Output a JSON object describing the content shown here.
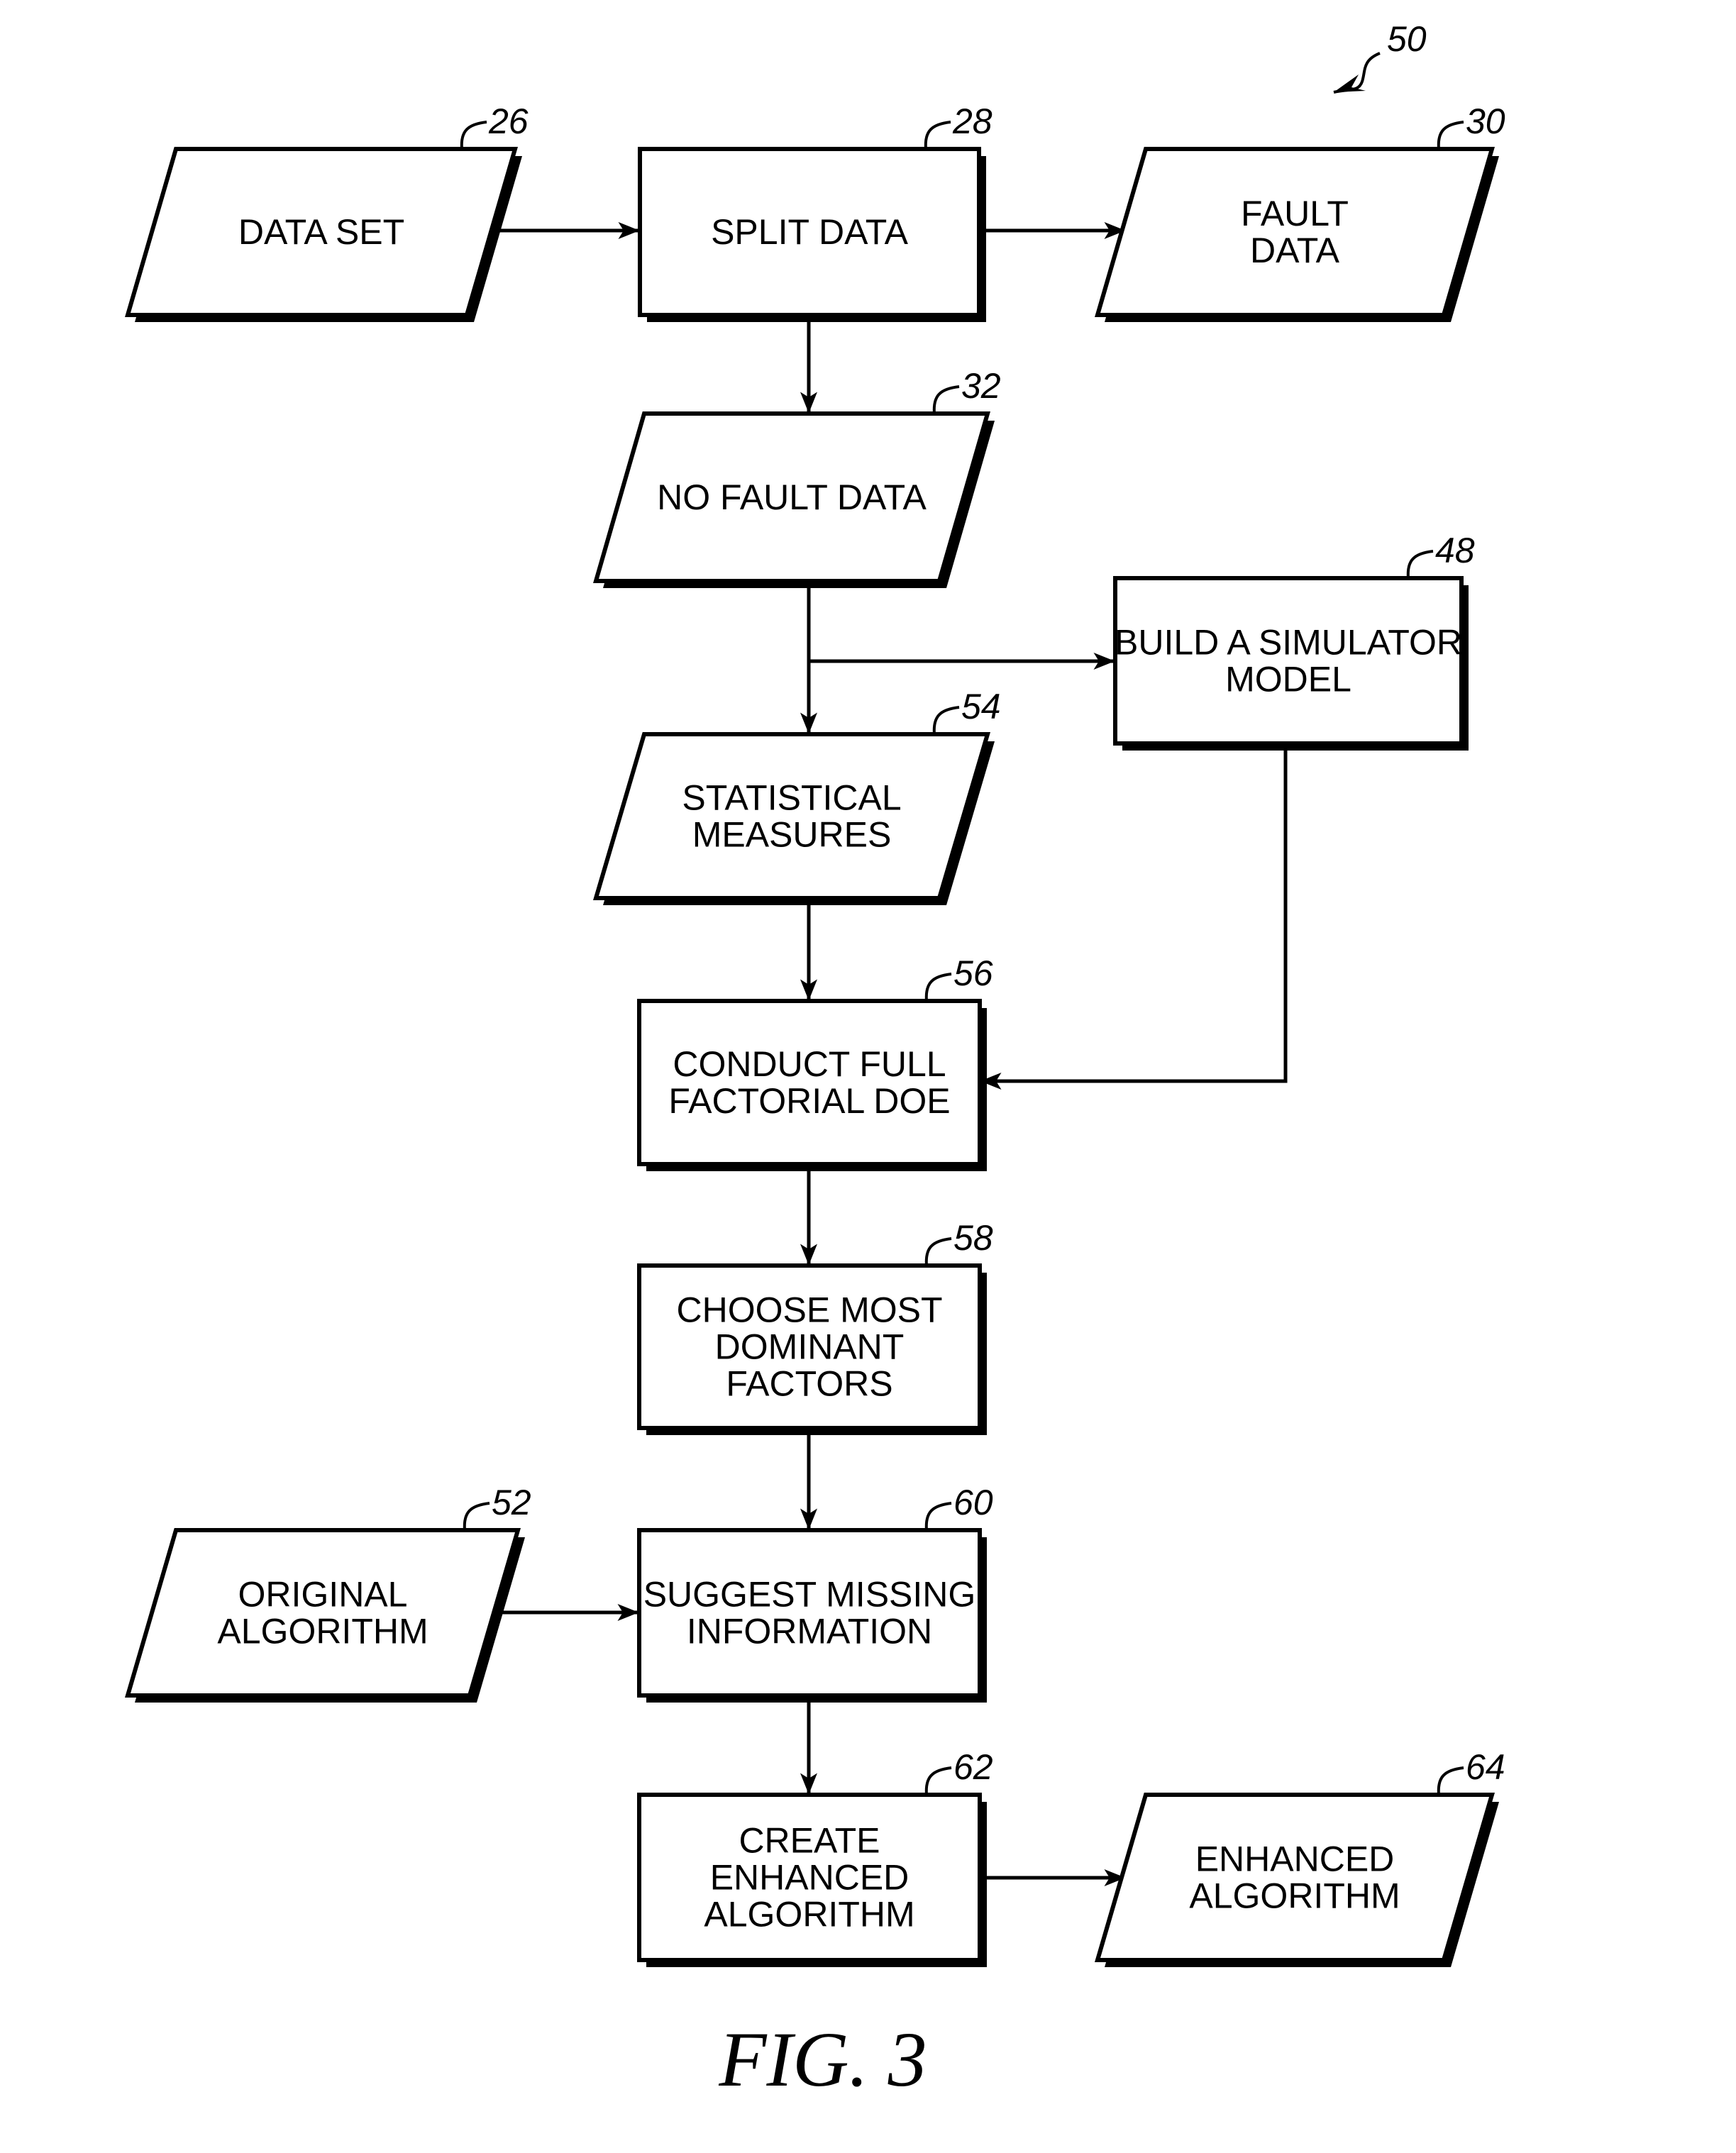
{
  "figure": {
    "caption": "FIG. 3",
    "reference": "50"
  },
  "nodes": [
    {
      "id": "data-set",
      "ref": "26",
      "shape": "parallelogram",
      "lines": [
        "DATA SET"
      ]
    },
    {
      "id": "split-data",
      "ref": "28",
      "shape": "rect",
      "lines": [
        "SPLIT DATA"
      ]
    },
    {
      "id": "fault-data",
      "ref": "30",
      "shape": "parallelogram",
      "lines": [
        "FAULT",
        "DATA"
      ]
    },
    {
      "id": "no-fault-data",
      "ref": "32",
      "shape": "parallelogram",
      "lines": [
        "NO FAULT DATA"
      ]
    },
    {
      "id": "build-simulator-model",
      "ref": "48",
      "shape": "rect",
      "lines": [
        "BUILD A SIMULATOR",
        "MODEL"
      ]
    },
    {
      "id": "statistical-measures",
      "ref": "54",
      "shape": "parallelogram",
      "lines": [
        "STATISTICAL",
        "MEASURES"
      ]
    },
    {
      "id": "conduct-full-factorial-doe",
      "ref": "56",
      "shape": "rect",
      "lines": [
        "CONDUCT FULL",
        "FACTORIAL DOE"
      ]
    },
    {
      "id": "choose-most-dominant-factors",
      "ref": "58",
      "shape": "rect",
      "lines": [
        "CHOOSE MOST",
        "DOMINANT",
        "FACTORS"
      ]
    },
    {
      "id": "original-algorithm",
      "ref": "52",
      "shape": "parallelogram",
      "lines": [
        "ORIGINAL",
        "ALGORITHM"
      ]
    },
    {
      "id": "suggest-missing-information",
      "ref": "60",
      "shape": "rect",
      "lines": [
        "SUGGEST MISSING",
        "INFORMATION"
      ]
    },
    {
      "id": "create-enhanced-algorithm",
      "ref": "62",
      "shape": "rect",
      "lines": [
        "CREATE",
        "ENHANCED",
        "ALGORITHM"
      ]
    },
    {
      "id": "enhanced-algorithm",
      "ref": "64",
      "shape": "parallelogram",
      "lines": [
        "ENHANCED",
        "ALGORITHM"
      ]
    }
  ],
  "edges": [
    {
      "from": "data-set",
      "to": "split-data"
    },
    {
      "from": "split-data",
      "to": "fault-data"
    },
    {
      "from": "split-data",
      "to": "no-fault-data"
    },
    {
      "from": "no-fault-data",
      "to": "build-simulator-model"
    },
    {
      "from": "no-fault-data",
      "to": "statistical-measures"
    },
    {
      "from": "statistical-measures",
      "to": "conduct-full-factorial-doe"
    },
    {
      "from": "build-simulator-model",
      "to": "conduct-full-factorial-doe"
    },
    {
      "from": "conduct-full-factorial-doe",
      "to": "choose-most-dominant-factors"
    },
    {
      "from": "choose-most-dominant-factors",
      "to": "suggest-missing-information"
    },
    {
      "from": "original-algorithm",
      "to": "suggest-missing-information"
    },
    {
      "from": "suggest-missing-information",
      "to": "create-enhanced-algorithm"
    },
    {
      "from": "create-enhanced-algorithm",
      "to": "enhanced-algorithm"
    }
  ]
}
